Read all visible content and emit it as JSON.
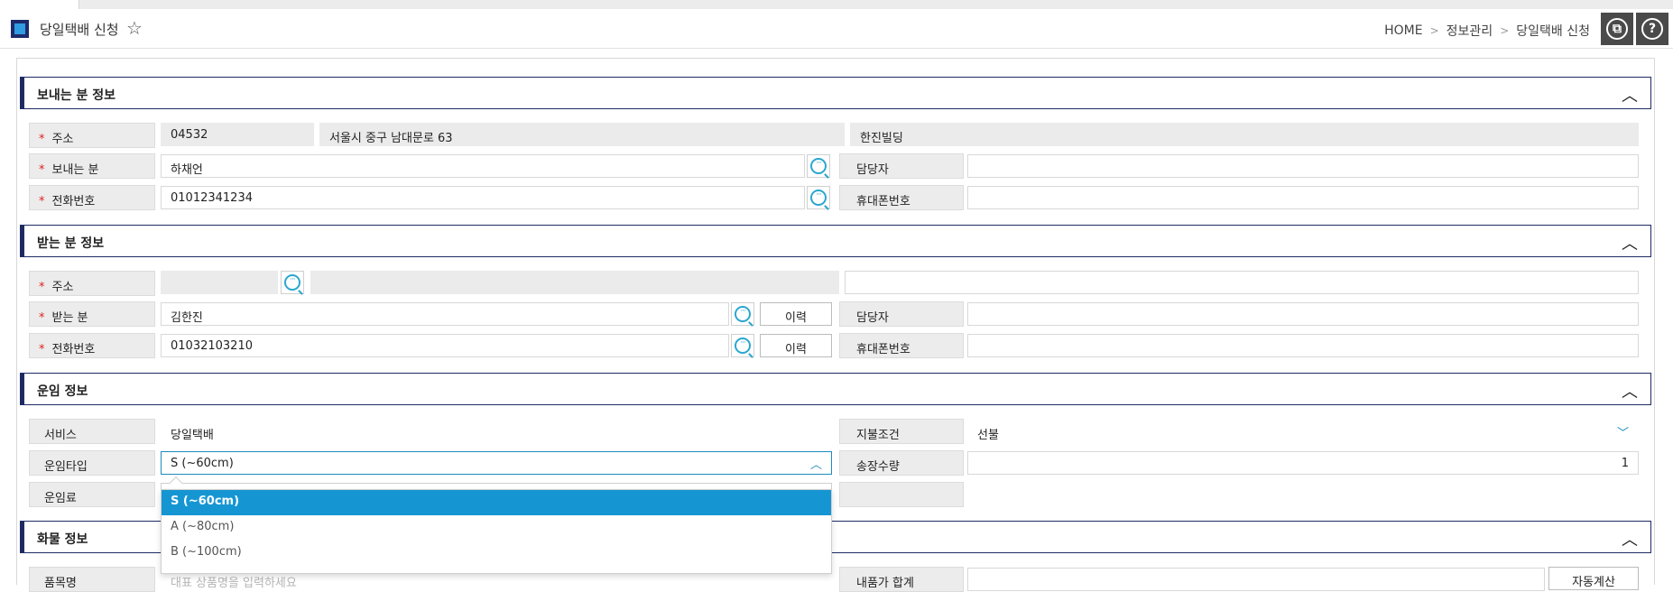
{
  "header": {
    "title": "당일택배 신청",
    "breadcrumb": [
      "HOME",
      "정보관리",
      "당일택배 신청"
    ]
  },
  "icons": {
    "star": "star-outline-icon",
    "window": "window-icon",
    "help": "help-icon",
    "search": "search-icon",
    "collapse": "chevron-up-icon"
  },
  "colors": {
    "accent": "#1e2b63",
    "highlight": "#1596d3",
    "required": "#e02020"
  },
  "sender": {
    "section_title": "보내는 분 정보",
    "address_label": "주소",
    "zipcode": "04532",
    "address": "서울시 중구 남대문로 63",
    "address_detail": "한진빌딩",
    "name_label": "보내는 분",
    "name": "하채언",
    "manager_label": "담당자",
    "manager": "",
    "phone_label": "전화번호",
    "phone": "01012341234",
    "mobile_label": "휴대폰번호",
    "mobile": ""
  },
  "receiver": {
    "section_title": "받는 분 정보",
    "address_label": "주소",
    "zipcode": "",
    "address": "",
    "address_detail": "",
    "name_label": "받는 분",
    "name": "김한진",
    "history_label": "이력",
    "manager_label": "담당자",
    "manager": "",
    "phone_label": "전화번호",
    "phone": "01032103210",
    "mobile_label": "휴대폰번호",
    "mobile": ""
  },
  "freight": {
    "section_title": "운임 정보",
    "service_label": "서비스",
    "service": "당일택배",
    "payment_label": "지불조건",
    "payment": "선불",
    "fare_type_label": "운임타입",
    "fare_type": "S (~60cm)",
    "waybill_qty_label": "송장수량",
    "waybill_qty": "1",
    "fare_label": "운임료",
    "fare_type_options": [
      "S (~60cm)",
      "A (~80cm)",
      "B (~100cm)"
    ]
  },
  "cargo": {
    "section_title": "화물 정보",
    "item_label": "품목명",
    "item_placeholder": "대표 상품명을 입력하세요",
    "total_label": "내품가 합계",
    "auto_calc_label": "자동계산"
  }
}
